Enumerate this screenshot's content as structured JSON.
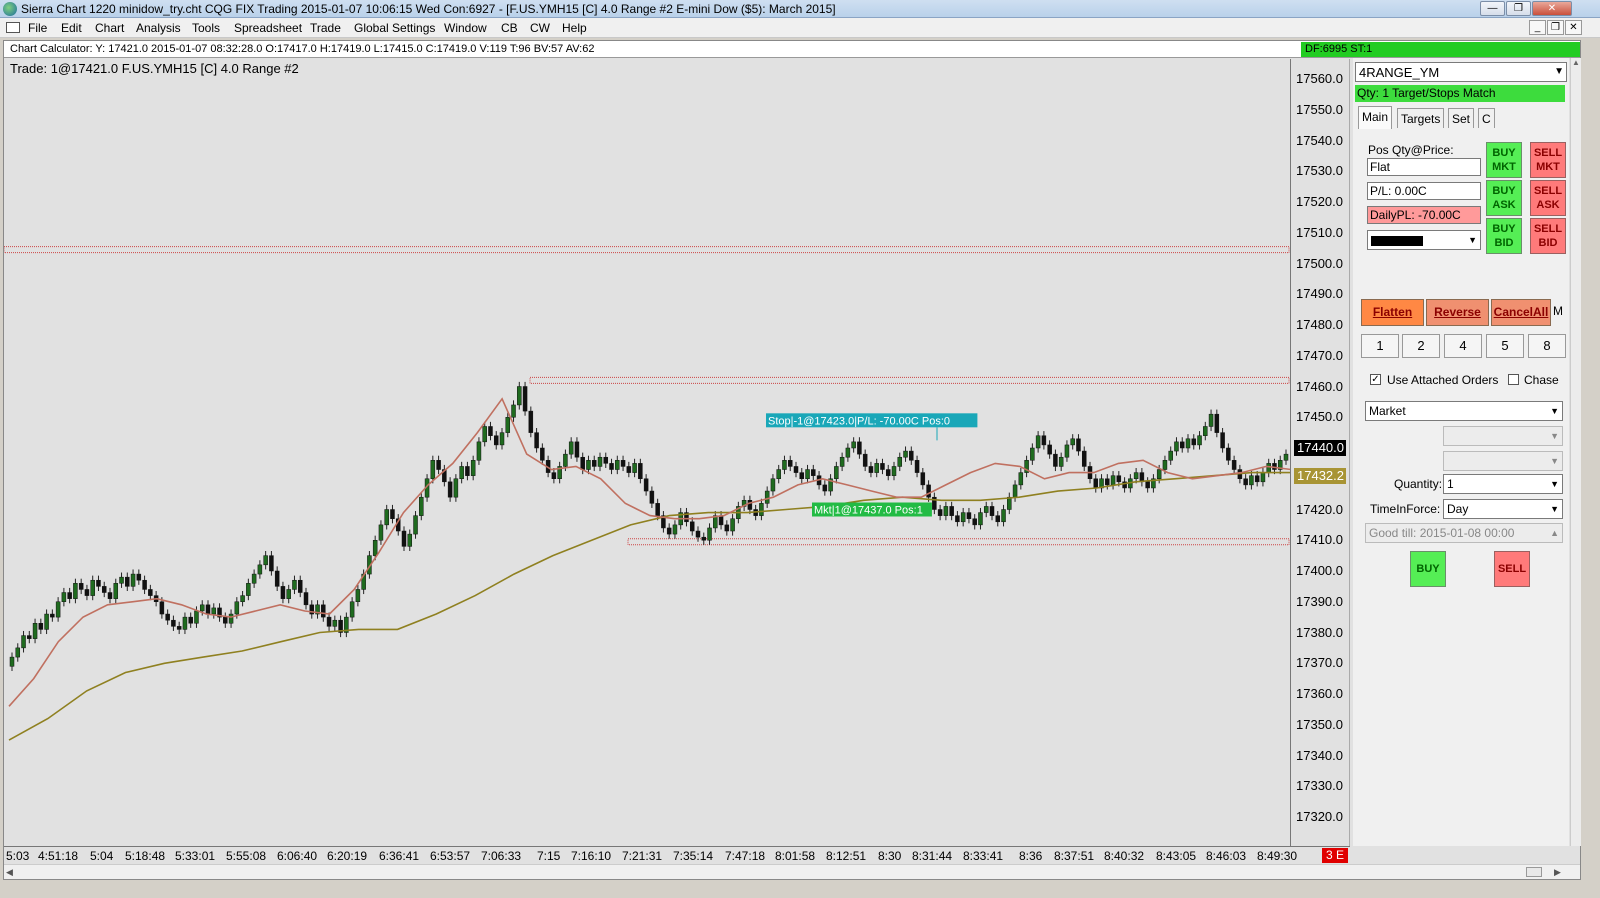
{
  "window": {
    "title": "Sierra Chart 1220 minidow_try.cht  CQG FIX Trading 2015-01-07  10:06:15 Wed   Con:6927 - [F.US.YMH15 [C]  4.0 Range  #2   E-mini Dow ($5): March 2015]",
    "minimize": "—",
    "restore": "❐",
    "close": "✕"
  },
  "menu": {
    "items": [
      "File",
      "Edit",
      "Chart",
      "Analysis",
      "Tools",
      "Spreadsheet",
      "Trade",
      "Global Settings",
      "Window",
      "CB",
      "CW",
      "Help"
    ],
    "mdi_minimize": "_",
    "mdi_restore": "❐",
    "mdi_close": "✕"
  },
  "calculator": {
    "text": "Chart Calculator: Y: 17421.0  2015-01-07  08:32:28.0  O:17417.0  H:17419.0  L:17415.0  C:17419.0  V:119  T:96  BV:57  AV:62",
    "df_status": "DF:6995  ST:1"
  },
  "chart": {
    "trade_label": "Trade:  1@17421.0  F.US.YMH15 [C]  4.0 Range  #2",
    "stop_label": "Stop|-1@17423.0|P/L: -70.00C Pos:0",
    "mkt_label": "Mkt|1@17437.0 Pos:1",
    "current_price": "17440.0",
    "ma_price": "17432.2",
    "badge": "3 E",
    "colors": {
      "background": "#e1e1e1",
      "up_candle": "#1f6b1f",
      "down_candle": "#111111",
      "ma_fast": "#c07060",
      "ma_slow": "#8f8020",
      "stop_label_bg": "#19a7b8",
      "mkt_label_bg": "#22bb44",
      "hline": "#cc4444"
    }
  },
  "chart_data": {
    "type": "candlestick",
    "price_ticks": [
      "17560.0",
      "17550.0",
      "17540.0",
      "17530.0",
      "17520.0",
      "17510.0",
      "17500.0",
      "17490.0",
      "17480.0",
      "17470.0",
      "17460.0",
      "17450.0",
      "17440.0",
      "17430.0",
      "17420.0",
      "17410.0",
      "17400.0",
      "17390.0",
      "17380.0",
      "17370.0",
      "17360.0",
      "17350.0",
      "17340.0",
      "17330.0",
      "17320.0"
    ],
    "time_ticks": [
      "5:03",
      "4:51:18",
      "5:04",
      "5:18:48",
      "5:33:01",
      "5:55:08",
      "6:06:40",
      "6:20:19",
      "6:36:41",
      "6:53:57",
      "7:06:33",
      "7:15",
      "7:16:10",
      "7:21:31",
      "7:35:14",
      "7:47:18",
      "8:01:58",
      "8:12:51",
      "8:30",
      "8:31:44",
      "8:33:41",
      "8:36",
      "8:37:51",
      "8:40:32",
      "8:43:05",
      "8:46:03",
      "8:49:30"
    ],
    "ylim": [
      17313,
      17566
    ],
    "price_lines": [
      17504.5,
      17462.0,
      17409.5
    ],
    "stop_price": 17449.0,
    "mkt_price": 17420.0,
    "closes": [
      17372,
      17375,
      17379,
      17378,
      17383,
      17381,
      17386,
      17385,
      17390,
      17393,
      17391,
      17396,
      17394,
      17392,
      17397,
      17395,
      17393,
      17391,
      17396,
      17398,
      17395,
      17399,
      17397,
      17394,
      17392,
      17390,
      17386,
      17384,
      17382,
      17381,
      17385,
      17383,
      17387,
      17389,
      17386,
      17388,
      17385,
      17383,
      17386,
      17390,
      17392,
      17396,
      17399,
      17402,
      17405,
      17400,
      17395,
      17391,
      17394,
      17397,
      17393,
      17389,
      17386,
      17389,
      17385,
      17382,
      17384,
      17380,
      17385,
      17390,
      17394,
      17399,
      17405,
      17410,
      17415,
      17420,
      17417,
      17413,
      17408,
      17412,
      17418,
      17424,
      17430,
      17436,
      17433,
      17429,
      17424,
      17430,
      17434,
      17431,
      17436,
      17442,
      17447,
      17444,
      17441,
      17445,
      17450,
      17454,
      17460,
      17452,
      17445,
      17440,
      17436,
      17432,
      17430,
      17434,
      17438,
      17442,
      17437,
      17433,
      17436,
      17434,
      17437,
      17435,
      17433,
      17436,
      17434,
      17432,
      17435,
      17430,
      17426,
      17422,
      17418,
      17414,
      17412,
      17415,
      17419,
      17416,
      17413,
      17411,
      17410,
      17414,
      17418,
      17415,
      17413,
      17417,
      17421,
      17423,
      17420,
      17418,
      17422,
      17426,
      17430,
      17433,
      17436,
      17434,
      17432,
      17430,
      17433,
      17431,
      17428,
      17426,
      17430,
      17434,
      17437,
      17440,
      17442,
      17438,
      17434,
      17432,
      17435,
      17433,
      17431,
      17434,
      17437,
      17439,
      17436,
      17432,
      17428,
      17424,
      17420,
      17418,
      17421,
      17418,
      17416,
      17419,
      17417,
      17415,
      17419,
      17421,
      17418,
      17416,
      17420,
      17424,
      17428,
      17432,
      17436,
      17440,
      17444,
      17441,
      17438,
      17434,
      17437,
      17441,
      17443,
      17439,
      17434,
      17430,
      17427,
      17430,
      17428,
      17431,
      17429,
      17427,
      17430,
      17432,
      17429,
      17427,
      17430,
      17433,
      17436,
      17439,
      17442,
      17440,
      17443,
      17441,
      17444,
      17447,
      17451,
      17445,
      17440,
      17436,
      17433,
      17430,
      17428,
      17431,
      17429,
      17432,
      17435,
      17433,
      17436,
      17438
    ],
    "ma_fast": [
      17356,
      17365,
      17377,
      17385,
      17389,
      17390,
      17391,
      17389,
      17386,
      17385,
      17387,
      17389,
      17387,
      17386,
      17394,
      17406,
      17419,
      17428,
      17435,
      17445,
      17456,
      17438,
      17433,
      17434,
      17430,
      17422,
      17418,
      17417,
      17417,
      17418,
      17422,
      17424,
      17428,
      17430,
      17428,
      17426,
      17424,
      17424,
      17428,
      17432,
      17435,
      17434,
      17430,
      17432,
      17432,
      17435,
      17436,
      17432,
      17430,
      17431,
      17432,
      17434,
      17433
    ],
    "ma_slow": [
      17345,
      17352,
      17361,
      17367,
      17370,
      17372,
      17374,
      17377,
      17380,
      17381,
      17381,
      17386,
      17392,
      17399,
      17405,
      17410,
      17415,
      17418,
      17419,
      17419,
      17420,
      17421,
      17423,
      17424,
      17423,
      17423,
      17424,
      17426,
      17427,
      17429,
      17430,
      17431,
      17432,
      17432
    ]
  },
  "panel": {
    "symbol": "4RANGE_YM",
    "qty_bar": "Qty: 1 Target/Stops Match",
    "tabs": [
      "Main",
      "Targets",
      "Set",
      "C"
    ],
    "pos_label": "Pos Qty@Price:",
    "pos_value": "Flat",
    "pl_value": "P/L: 0.00C",
    "daily_pl": "DailyPL: -70.00C",
    "buy_mkt": "BUY MKT",
    "sell_mkt": "SELL MKT",
    "buy_ask": "BUY ASK",
    "sell_ask": "SELL ASK",
    "buy_bid": "BUY BID",
    "sell_bid": "SELL BID",
    "flatten": "Flatten",
    "reverse": "Reverse",
    "cancel_all": "CancelAll",
    "m": "M",
    "qty_buttons": [
      "1",
      "2",
      "4",
      "5",
      "8"
    ],
    "use_attached": "Use Attached Orders",
    "chase": "Chase",
    "order_type": "Market",
    "quantity_label": "Quantity:",
    "quantity_value": "1",
    "tif_label": "TimeInForce:",
    "tif_value": "Day",
    "good_till": "Good till: 2015-01-08 00:00",
    "buy": "BUY",
    "sell": "SELL"
  }
}
